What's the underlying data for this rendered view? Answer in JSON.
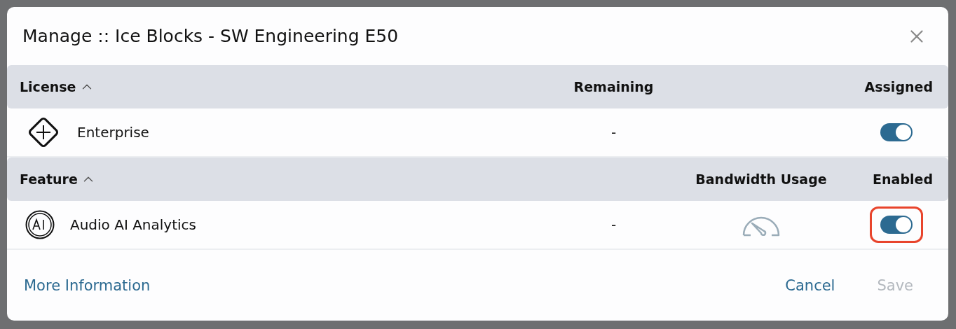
{
  "dialog": {
    "title": "Manage :: Ice Blocks - SW Engineering E50"
  },
  "sections": [
    {
      "kind": "license",
      "columns": [
        {
          "label": "License",
          "sort_ascending": true
        },
        {
          "label": "Remaining"
        },
        {},
        {
          "label": "Assigned"
        }
      ],
      "rows": [
        {
          "name": "Enterprise",
          "remaining": "-",
          "on": true,
          "highlighted": false
        }
      ]
    },
    {
      "kind": "feature",
      "columns": [
        {
          "label": "Feature",
          "sort_ascending": true
        },
        {},
        {
          "label": "Bandwidth Usage"
        },
        {
          "label": "Enabled"
        }
      ],
      "rows": [
        {
          "name": "Audio AI Analytics",
          "remaining": "-",
          "on": true,
          "highlighted": true
        }
      ]
    }
  ],
  "footer": {
    "link": "More Information",
    "buttons": [
      {
        "label": "Cancel",
        "disabled": false
      },
      {
        "label": "Save",
        "disabled": true
      }
    ]
  }
}
